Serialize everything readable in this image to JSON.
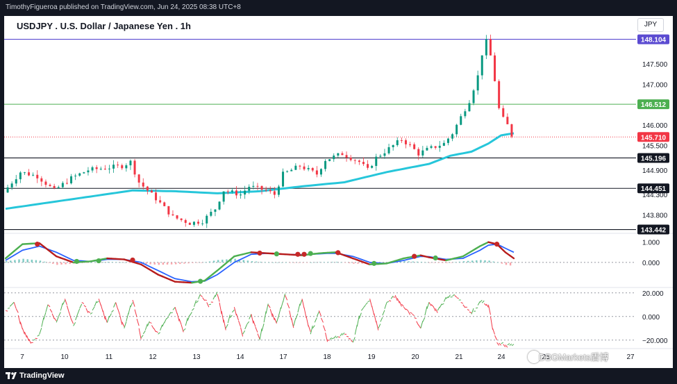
{
  "header": {
    "published_text": "TimothyFigueroa published on TradingView.com, Jun 24, 2025 08:38 UTC+8",
    "title": "USDJPY . U.S. Dollar / Japanese Yen . 1h",
    "currency": "JPY"
  },
  "footer": {
    "brand": "TradingView",
    "watermark": "DBGMarkets盾博"
  },
  "colors": {
    "candle_up": "#089981",
    "candle_down": "#f23645",
    "ema": "#26c6da",
    "top_line": "#5b4bd1",
    "green_line": "#4caf50",
    "support_line": "#131722",
    "current_price_line": "#f23645",
    "wt1": "#4caf50",
    "wt1_down": "#b71c1c",
    "wt2": "#2962ff",
    "osc_up": "#4caf50",
    "osc_down": "#f23645"
  },
  "chart_data": [
    {
      "type": "candlestick",
      "name": "USDJPY 1h",
      "x_ticks": [
        "7",
        "10",
        "11",
        "12",
        "13",
        "14",
        "17",
        "18",
        "19",
        "20",
        "21",
        "24",
        "25",
        "27"
      ],
      "y_ticks": [
        "147.500",
        "147.000",
        "146.000",
        "145.500",
        "144.900",
        "144.300",
        "143.800"
      ],
      "ylim": [
        143.4,
        148.25
      ],
      "price_path": [
        [
          0,
          144.35
        ],
        [
          4,
          144.85
        ],
        [
          8,
          144.75
        ],
        [
          12,
          144.4
        ],
        [
          16,
          144.7
        ],
        [
          20,
          144.9
        ],
        [
          24,
          144.95
        ],
        [
          28,
          145.0
        ],
        [
          30,
          145.1
        ],
        [
          32,
          144.6
        ],
        [
          36,
          144.2
        ],
        [
          40,
          143.75
        ],
        [
          44,
          143.6
        ],
        [
          47,
          143.65
        ],
        [
          50,
          143.95
        ],
        [
          52,
          144.4
        ],
        [
          56,
          144.3
        ],
        [
          58,
          144.5
        ],
        [
          62,
          144.4
        ],
        [
          64,
          144.3
        ],
        [
          66,
          144.8
        ],
        [
          70,
          145.0
        ],
        [
          74,
          144.8
        ],
        [
          76,
          145.15
        ],
        [
          80,
          145.3
        ],
        [
          84,
          145.1
        ],
        [
          86,
          144.9
        ],
        [
          88,
          145.2
        ],
        [
          92,
          145.5
        ],
        [
          94,
          145.65
        ],
        [
          96,
          145.5
        ],
        [
          98,
          145.3
        ],
        [
          100,
          145.4
        ],
        [
          104,
          145.55
        ],
        [
          106,
          145.8
        ],
        [
          108,
          146.2
        ],
        [
          110,
          146.6
        ],
        [
          112,
          147.2
        ],
        [
          113,
          147.75
        ],
        [
          114,
          148.05
        ],
        [
          115,
          147.7
        ],
        [
          116,
          147.1
        ],
        [
          117,
          146.4
        ],
        [
          118,
          146.15
        ],
        [
          119,
          146.0
        ],
        [
          120,
          145.75
        ]
      ],
      "current_price": 145.71,
      "lines": [
        {
          "label": "148.104",
          "value": 148.104,
          "kind": "top"
        },
        {
          "label": "146.512",
          "value": 146.512,
          "kind": "green"
        },
        {
          "label": "145.196",
          "value": 145.196,
          "kind": "support"
        },
        {
          "label": "144.451",
          "value": 144.451,
          "kind": "support"
        },
        {
          "label": "143.442",
          "value": 143.442,
          "kind": "support"
        }
      ],
      "current_label": "145.710",
      "ema": [
        [
          0,
          143.95
        ],
        [
          10,
          144.1
        ],
        [
          20,
          144.25
        ],
        [
          30,
          144.4
        ],
        [
          40,
          144.38
        ],
        [
          50,
          144.33
        ],
        [
          60,
          144.38
        ],
        [
          70,
          144.5
        ],
        [
          80,
          144.6
        ],
        [
          90,
          144.85
        ],
        [
          100,
          145.05
        ],
        [
          105,
          145.25
        ],
        [
          110,
          145.35
        ],
        [
          114,
          145.55
        ],
        [
          117,
          145.75
        ],
        [
          120,
          145.8
        ]
      ]
    },
    {
      "type": "line",
      "name": "WaveTrend",
      "y_ticks": [
        "1.000",
        "0.000"
      ],
      "ylim": [
        -1.2,
        1.4
      ],
      "wt1": [
        [
          0,
          0.2
        ],
        [
          4,
          0.9
        ],
        [
          8,
          0.95
        ],
        [
          12,
          0.3
        ],
        [
          16,
          0.0
        ],
        [
          20,
          0.05
        ],
        [
          24,
          0.2
        ],
        [
          28,
          0.15
        ],
        [
          32,
          -0.1
        ],
        [
          36,
          -0.6
        ],
        [
          40,
          -0.95
        ],
        [
          44,
          -1.0
        ],
        [
          47,
          -0.9
        ],
        [
          50,
          -0.4
        ],
        [
          54,
          0.3
        ],
        [
          58,
          0.5
        ],
        [
          62,
          0.45
        ],
        [
          66,
          0.4
        ],
        [
          70,
          0.35
        ],
        [
          74,
          0.45
        ],
        [
          76,
          0.48
        ],
        [
          78,
          0.5
        ],
        [
          82,
          0.2
        ],
        [
          86,
          -0.1
        ],
        [
          90,
          -0.05
        ],
        [
          94,
          0.2
        ],
        [
          98,
          0.35
        ],
        [
          100,
          0.25
        ],
        [
          104,
          0.1
        ],
        [
          108,
          0.3
        ],
        [
          112,
          0.8
        ],
        [
          114,
          1.0
        ],
        [
          116,
          0.9
        ],
        [
          118,
          0.5
        ],
        [
          120,
          0.2
        ]
      ],
      "wt2": [
        [
          0,
          0.1
        ],
        [
          4,
          0.6
        ],
        [
          8,
          0.8
        ],
        [
          12,
          0.5
        ],
        [
          16,
          0.1
        ],
        [
          20,
          0.05
        ],
        [
          24,
          0.15
        ],
        [
          28,
          0.15
        ],
        [
          32,
          0.0
        ],
        [
          36,
          -0.4
        ],
        [
          40,
          -0.8
        ],
        [
          44,
          -0.95
        ],
        [
          47,
          -0.92
        ],
        [
          50,
          -0.6
        ],
        [
          54,
          0.0
        ],
        [
          58,
          0.4
        ],
        [
          62,
          0.45
        ],
        [
          66,
          0.4
        ],
        [
          70,
          0.38
        ],
        [
          74,
          0.42
        ],
        [
          76,
          0.45
        ],
        [
          78,
          0.45
        ],
        [
          82,
          0.3
        ],
        [
          86,
          0.0
        ],
        [
          90,
          -0.05
        ],
        [
          94,
          0.1
        ],
        [
          98,
          0.3
        ],
        [
          100,
          0.28
        ],
        [
          104,
          0.15
        ],
        [
          108,
          0.2
        ],
        [
          112,
          0.6
        ],
        [
          114,
          0.85
        ],
        [
          116,
          0.9
        ],
        [
          118,
          0.7
        ],
        [
          120,
          0.5
        ]
      ],
      "cross_dots": [
        {
          "x": 7.5,
          "y": 0.9,
          "dir": "down"
        },
        {
          "x": 16.8,
          "y": 0.05,
          "dir": "up"
        },
        {
          "x": 22,
          "y": 0.08,
          "dir": "up"
        },
        {
          "x": 30,
          "y": 0.12,
          "dir": "down"
        },
        {
          "x": 46,
          "y": -0.93,
          "dir": "up"
        },
        {
          "x": 60,
          "y": 0.46,
          "dir": "down"
        },
        {
          "x": 64,
          "y": 0.42,
          "dir": "up"
        },
        {
          "x": 69,
          "y": 0.4,
          "dir": "down"
        },
        {
          "x": 70.5,
          "y": 0.4,
          "dir": "down"
        },
        {
          "x": 72,
          "y": 0.44,
          "dir": "up"
        },
        {
          "x": 78.5,
          "y": 0.48,
          "dir": "down"
        },
        {
          "x": 87,
          "y": -0.05,
          "dir": "up"
        },
        {
          "x": 96.5,
          "y": 0.3,
          "dir": "down"
        },
        {
          "x": 101.5,
          "y": 0.22,
          "dir": "up"
        },
        {
          "x": 116,
          "y": 0.9,
          "dir": "down"
        }
      ]
    },
    {
      "type": "line",
      "name": "Oscillator",
      "y_ticks": [
        "20.000",
        "0.000",
        "−20.000"
      ],
      "ylim": [
        -26,
        24
      ],
      "values": [
        [
          0,
          5
        ],
        [
          2,
          12
        ],
        [
          4,
          -10
        ],
        [
          6,
          -22
        ],
        [
          8,
          -15
        ],
        [
          10,
          10
        ],
        [
          12,
          -5
        ],
        [
          14,
          15
        ],
        [
          16,
          -8
        ],
        [
          18,
          12
        ],
        [
          20,
          2
        ],
        [
          22,
          15
        ],
        [
          24,
          -5
        ],
        [
          26,
          12
        ],
        [
          28,
          -10
        ],
        [
          30,
          14
        ],
        [
          32,
          -18
        ],
        [
          34,
          -5
        ],
        [
          36,
          -15
        ],
        [
          38,
          -2
        ],
        [
          40,
          8
        ],
        [
          42,
          -12
        ],
        [
          44,
          5
        ],
        [
          46,
          18
        ],
        [
          48,
          10
        ],
        [
          50,
          19
        ],
        [
          52,
          -10
        ],
        [
          54,
          8
        ],
        [
          56,
          -15
        ],
        [
          58,
          2
        ],
        [
          60,
          -20
        ],
        [
          62,
          10
        ],
        [
          64,
          -5
        ],
        [
          66,
          18
        ],
        [
          68,
          -8
        ],
        [
          70,
          15
        ],
        [
          72,
          -15
        ],
        [
          74,
          5
        ],
        [
          76,
          -20
        ],
        [
          78,
          -18
        ],
        [
          80,
          -15
        ],
        [
          82,
          -22
        ],
        [
          84,
          5
        ],
        [
          86,
          15
        ],
        [
          88,
          -10
        ],
        [
          90,
          12
        ],
        [
          92,
          18
        ],
        [
          94,
          8
        ],
        [
          96,
          2
        ],
        [
          98,
          -10
        ],
        [
          100,
          12
        ],
        [
          102,
          5
        ],
        [
          104,
          15
        ],
        [
          106,
          18
        ],
        [
          108,
          10
        ],
        [
          110,
          2
        ],
        [
          112,
          12
        ],
        [
          114,
          10
        ],
        [
          115,
          -10
        ],
        [
          116,
          -22
        ],
        [
          118,
          -24
        ],
        [
          120,
          -25
        ]
      ]
    }
  ]
}
